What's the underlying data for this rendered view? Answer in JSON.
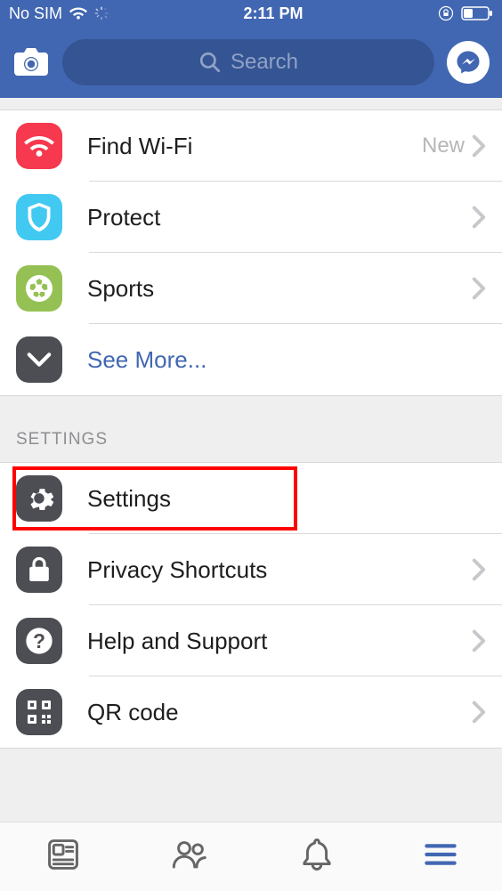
{
  "status": {
    "carrier": "No SIM",
    "time": "2:11 PM"
  },
  "header": {
    "search_placeholder": "Search"
  },
  "menu": {
    "find_wifi": "Find Wi-Fi",
    "find_wifi_badge": "New",
    "protect": "Protect",
    "sports": "Sports",
    "see_more": "See More..."
  },
  "settings_section": {
    "header": "SETTINGS",
    "settings": "Settings",
    "privacy": "Privacy Shortcuts",
    "help": "Help and Support",
    "qr": "QR code"
  },
  "colors": {
    "brand": "#4267B2",
    "icon_red": "#f6394e",
    "icon_cyan": "#41c9f2",
    "icon_green": "#95c154",
    "icon_dark": "#4d4e54"
  }
}
